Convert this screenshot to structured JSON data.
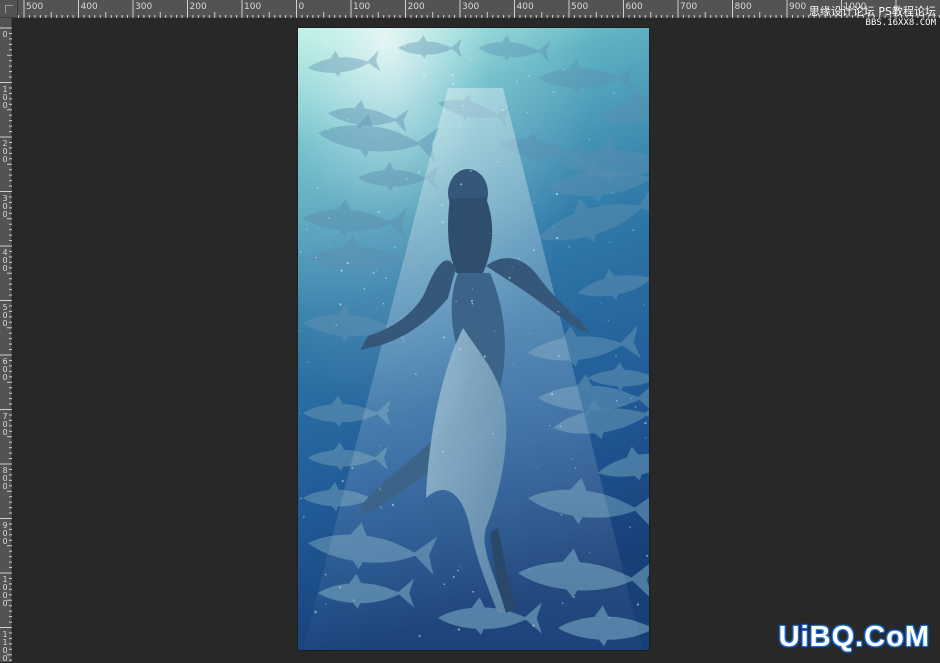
{
  "ruler_top": {
    "labels": [
      "500",
      "400",
      "300",
      "200",
      "100",
      "0",
      "100",
      "200",
      "300",
      "400",
      "500",
      "600",
      "700",
      "800",
      "900",
      "1000"
    ]
  },
  "ruler_left": {
    "labels": [
      "0",
      "100",
      "200",
      "300",
      "400",
      "500",
      "600",
      "700",
      "800",
      "900",
      "1000",
      "1100"
    ]
  },
  "canvas": {
    "image_description_name": "underwater-woman-swimming-with-tuna"
  },
  "watermark_top": {
    "line1": "思缘设计论坛 PS教程论坛",
    "line2": "BBS.16XX8.COM"
  },
  "watermark_bottom": {
    "text": "UiBQ.CoM"
  },
  "colors": {
    "workspace": "#282828",
    "ruler": "#535353",
    "water_top": "#a8e3da",
    "water_bottom": "#1c4f8f",
    "watermark_blue": "#1a6fd8"
  }
}
